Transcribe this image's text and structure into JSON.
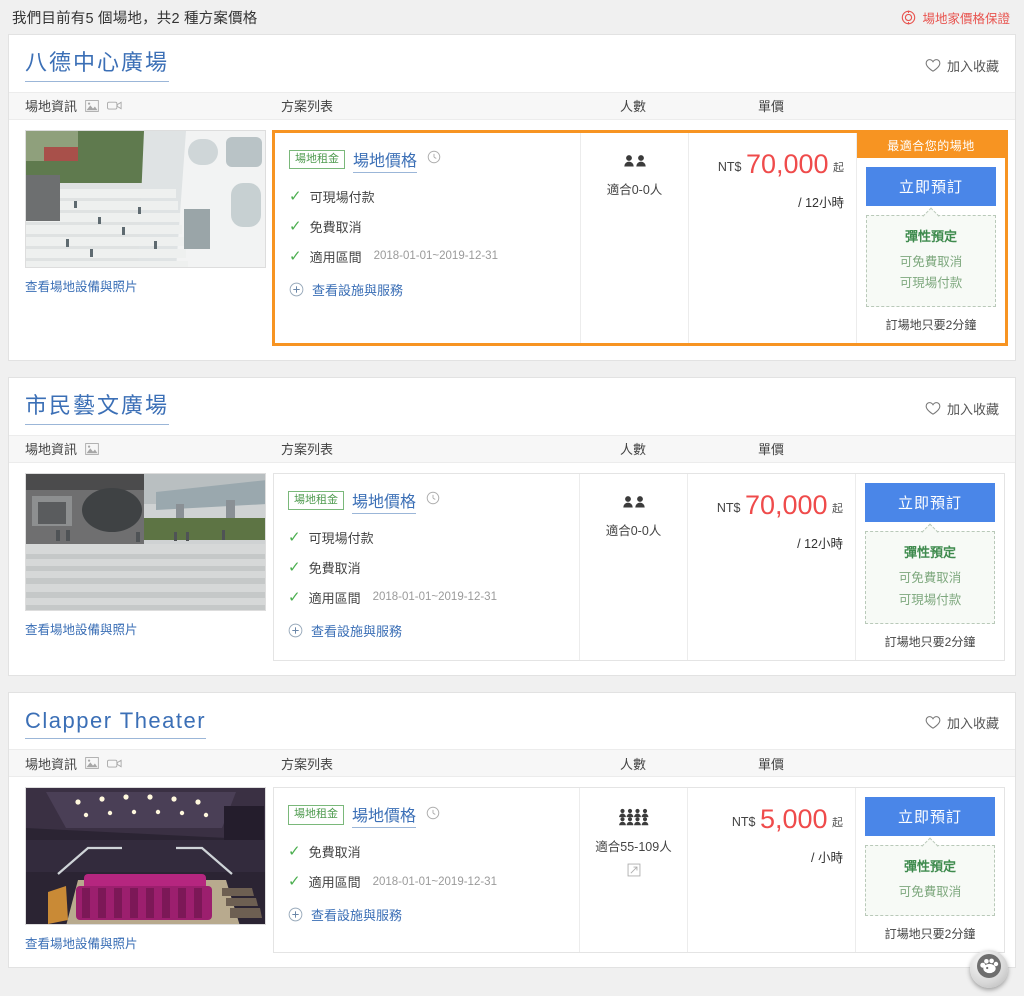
{
  "header": {
    "summary": "我們目前有5 個場地，共2 種方案價格",
    "guarantee_label": "場地家價格保證",
    "guarantee_icon": "target-circle-icon",
    "guarantee_color": "#e8544f"
  },
  "columns": {
    "info": "場地資訊",
    "plan": "方案列表",
    "people": "人數",
    "price": "單價"
  },
  "common": {
    "favorite_label": "加入收藏",
    "favorite_icon": "heart-outline-icon",
    "photo_link": "查看場地設備與照片",
    "rent_badge": "場地租金",
    "plan_name": "場地價格",
    "plan_clock_icon": "clock-icon",
    "more_services": "查看設施與服務",
    "more_icon": "plus-circle-icon",
    "currency": "NT$",
    "from_suffix": "起",
    "book_button": "立即預訂",
    "best_banner": "最適合您的場地",
    "flex_title": "彈性預定",
    "flex_free_cancel": "可免費取消",
    "flex_onsite_pay": "可現場付款",
    "quick_note": "訂場地只要2分鐘",
    "photo_icon": "image-icon",
    "video_icon": "video-icon",
    "people_icon": "people-icon",
    "expand_icon": "expand-square-icon",
    "accent_orange": "#f79422",
    "accent_blue": "#4a86e8",
    "price_red": "#ef4b4b",
    "link_blue": "#3b6fb6",
    "check_green": "#4caf50"
  },
  "venues": [
    {
      "title": "八德中心廣場",
      "latin": false,
      "has_video_icon": true,
      "featured": true,
      "photo": "outdoor-plaza-white-building",
      "features": [
        "可現場付款",
        "免費取消"
      ],
      "date_label": "適用區間",
      "date_range": "2018-01-01~2019-12-31",
      "people_text": "適合0-0人",
      "people_size": "small",
      "has_expand": false,
      "price": "70,000",
      "unit": "/ 12小時",
      "flex_items": [
        "可免費取消",
        "可現場付款"
      ]
    },
    {
      "title": "市民藝文廣場",
      "latin": false,
      "has_video_icon": false,
      "featured": false,
      "photo": "urban-plaza-overpass",
      "features": [
        "可現場付款",
        "免費取消"
      ],
      "date_label": "適用區間",
      "date_range": "2018-01-01~2019-12-31",
      "people_text": "適合0-0人",
      "people_size": "small",
      "has_expand": false,
      "price": "70,000",
      "unit": "/ 12小時",
      "flex_items": [
        "可免費取消",
        "可現場付款"
      ]
    },
    {
      "title": "Clapper Theater",
      "latin": true,
      "has_video_icon": true,
      "featured": false,
      "photo": "theater-pink-seats",
      "features": [
        "免費取消"
      ],
      "date_label": "適用區間",
      "date_range": "2018-01-01~2019-12-31",
      "people_text": "適合55-109人",
      "people_size": "large",
      "has_expand": true,
      "price": "5,000",
      "unit": "/ 小時",
      "flex_items": [
        "可免費取消"
      ]
    }
  ],
  "chat_widget": {
    "icon": "paw-chat-icon"
  }
}
